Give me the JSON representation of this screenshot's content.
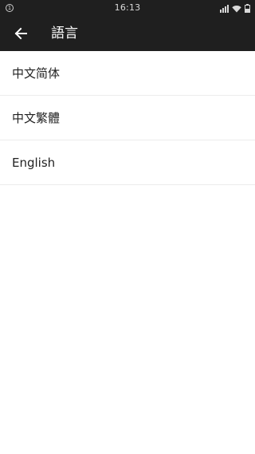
{
  "status_bar": {
    "notification": "1",
    "time": "16:13"
  },
  "toolbar": {
    "title": "語言",
    "back_icon": "arrow-left-icon"
  },
  "languages": [
    {
      "label": "中文简体"
    },
    {
      "label": "中文繁體"
    },
    {
      "label": "English"
    }
  ],
  "colors": {
    "toolbar_bg": "#1f1f1f",
    "background": "#ffffff",
    "divider": "#ececec",
    "text": "#222222"
  }
}
